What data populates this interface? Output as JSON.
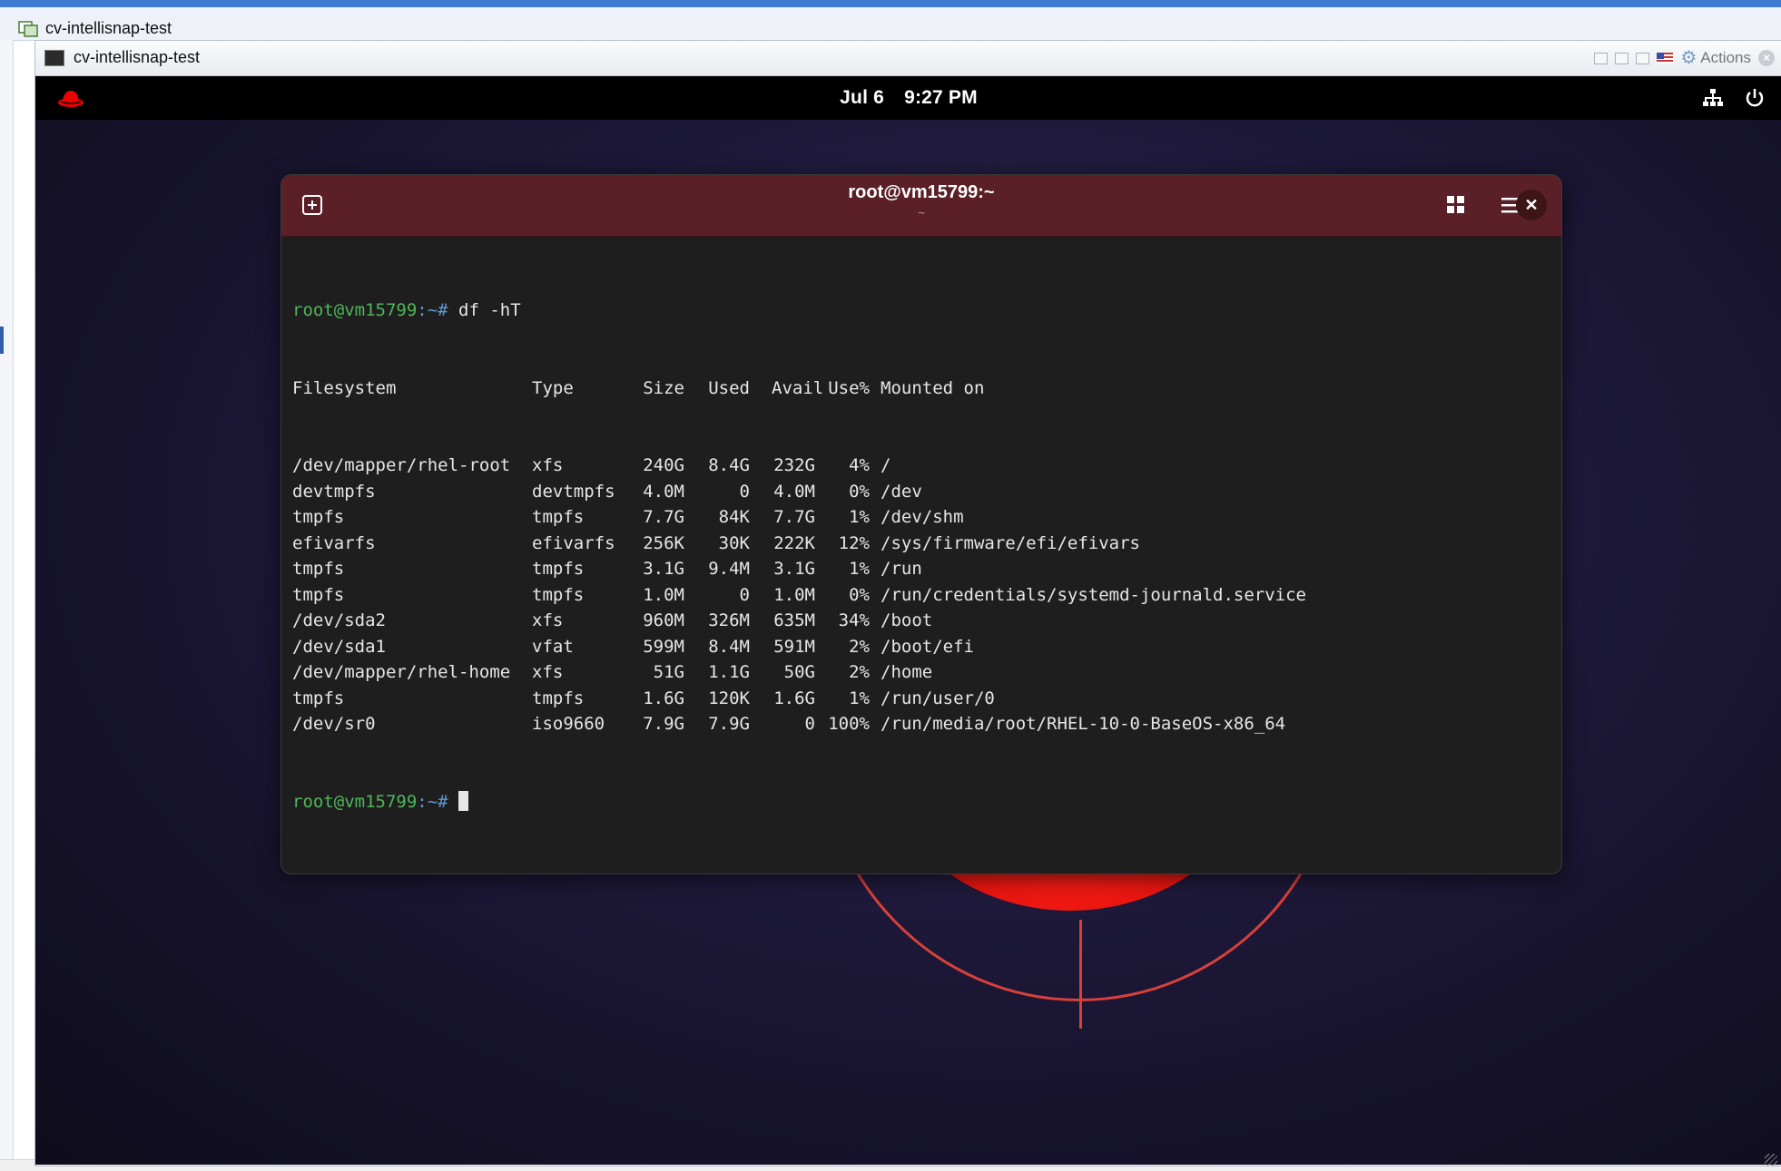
{
  "host": {
    "title": "cv-intellisnap-test"
  },
  "vm_window": {
    "title": "cv-intellisnap-test",
    "actions_label": "Actions"
  },
  "topbar": {
    "date": "Jul 6",
    "time": "9:27 PM"
  },
  "terminal": {
    "title": "root@vm15799:~",
    "subtitle": "~",
    "prompt_user": "root@vm15799",
    "prompt_sep": ":~#",
    "command": " df -hT",
    "header": {
      "filesystem": "Filesystem",
      "type": "Type",
      "size": "Size",
      "used": "Used",
      "avail": "Avail",
      "use_pct": "Use%",
      "mounted_on": "Mounted on"
    },
    "rows": [
      {
        "filesystem": "/dev/mapper/rhel-root",
        "type": "xfs",
        "size": "240G",
        "used": "8.4G",
        "avail": "232G",
        "use_pct": "4%",
        "mounted_on": "/"
      },
      {
        "filesystem": "devtmpfs",
        "type": "devtmpfs",
        "size": "4.0M",
        "used": "0",
        "avail": "4.0M",
        "use_pct": "0%",
        "mounted_on": "/dev"
      },
      {
        "filesystem": "tmpfs",
        "type": "tmpfs",
        "size": "7.7G",
        "used": "84K",
        "avail": "7.7G",
        "use_pct": "1%",
        "mounted_on": "/dev/shm"
      },
      {
        "filesystem": "efivarfs",
        "type": "efivarfs",
        "size": "256K",
        "used": "30K",
        "avail": "222K",
        "use_pct": "12%",
        "mounted_on": "/sys/firmware/efi/efivars"
      },
      {
        "filesystem": "tmpfs",
        "type": "tmpfs",
        "size": "3.1G",
        "used": "9.4M",
        "avail": "3.1G",
        "use_pct": "1%",
        "mounted_on": "/run"
      },
      {
        "filesystem": "tmpfs",
        "type": "tmpfs",
        "size": "1.0M",
        "used": "0",
        "avail": "1.0M",
        "use_pct": "0%",
        "mounted_on": "/run/credentials/systemd-journald.service"
      },
      {
        "filesystem": "/dev/sda2",
        "type": "xfs",
        "size": "960M",
        "used": "326M",
        "avail": "635M",
        "use_pct": "34%",
        "mounted_on": "/boot"
      },
      {
        "filesystem": "/dev/sda1",
        "type": "vfat",
        "size": "599M",
        "used": "8.4M",
        "avail": "591M",
        "use_pct": "2%",
        "mounted_on": "/boot/efi"
      },
      {
        "filesystem": "/dev/mapper/rhel-home",
        "type": "xfs",
        "size": "51G",
        "used": "1.1G",
        "avail": "50G",
        "use_pct": "2%",
        "mounted_on": "/home"
      },
      {
        "filesystem": "tmpfs",
        "type": "tmpfs",
        "size": "1.6G",
        "used": "120K",
        "avail": "1.6G",
        "use_pct": "1%",
        "mounted_on": "/run/user/0"
      },
      {
        "filesystem": "/dev/sr0",
        "type": "iso9660",
        "size": "7.9G",
        "used": "7.9G",
        "avail": "0",
        "use_pct": "100%",
        "mounted_on": "/run/media/root/RHEL-10-0-BaseOS-x86_64"
      }
    ]
  },
  "icons": {
    "host_app": "vm-console-icon",
    "vm_app": "terminal-screen-icon",
    "new_tab": "new-tab-icon",
    "view": "grid-view-icon",
    "menu": "hamburger-menu-icon",
    "close": "close-icon",
    "network": "network-icon",
    "power": "power-icon",
    "settings": "gear-icon"
  },
  "colors": {
    "terminal_header": "#5a1f27",
    "terminal_bg": "#1e1e1e",
    "prompt_user": "#4fb65a",
    "prompt_path": "#5c9bd6",
    "redhat_red": "#ee0000"
  }
}
